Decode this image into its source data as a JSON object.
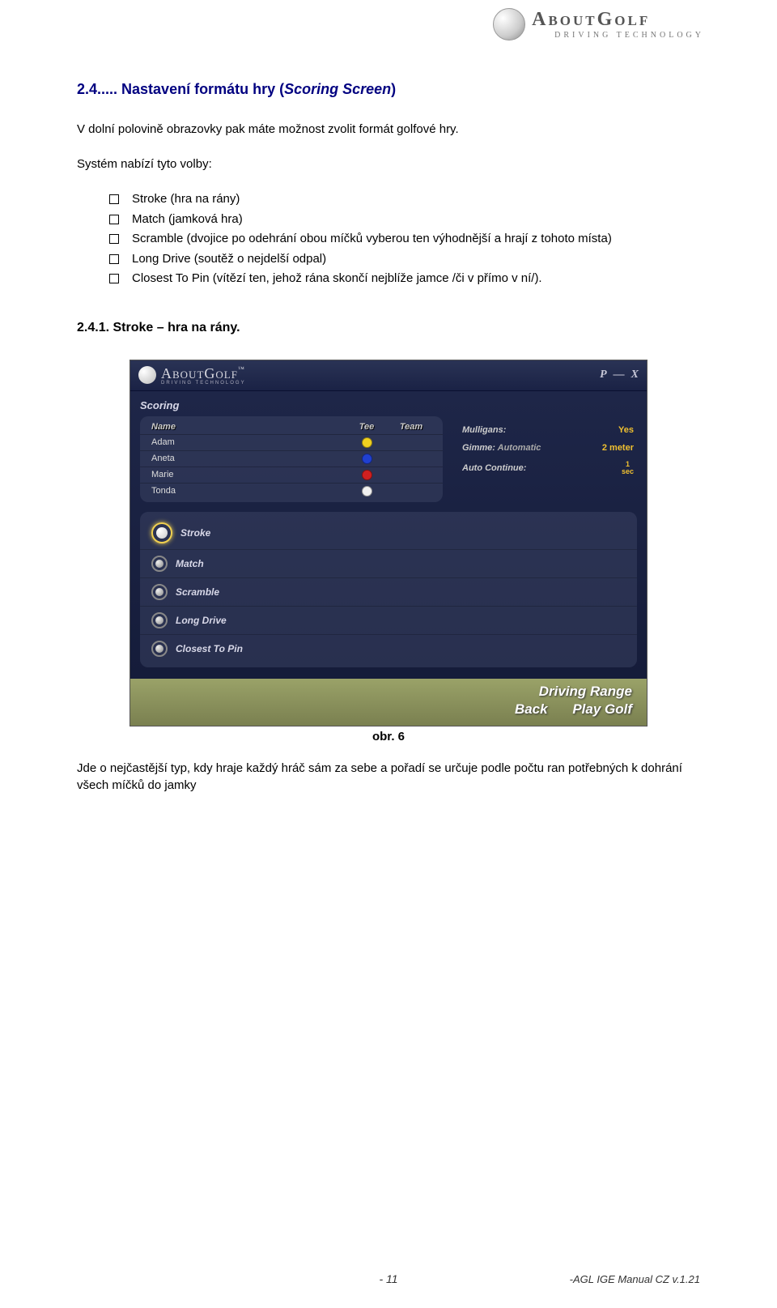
{
  "logo": {
    "brand_a": "About",
    "brand_b": "Golf",
    "sub": "DRIVING  TECHNOLOGY"
  },
  "heading": {
    "num": "2.4..... Nastavení formátu hry (",
    "italic": "Scoring Screen",
    "end": ")"
  },
  "intro": "V dolní polovině obrazovky pak máte možnost zvolit formát golfové hry.",
  "list_intro": "Systém nabízí tyto volby:",
  "bullets": [
    "Stroke (hra na rány)",
    "Match (jamková hra)",
    "Scramble (dvojice po odehrání obou míčků vyberou ten výhodnější a hrají z tohoto místa)",
    "Long Drive (soutěž o nejdelší odpal)",
    "Closest To Pin (vítězí ten, jehož rána skončí nejblíže jamce /či v přímo v ní/)."
  ],
  "subheading": "2.4.1.  Stroke – hra na rány.",
  "app": {
    "logo_a": "About",
    "logo_b": "Golf",
    "logo_tm": "™",
    "logo_sub": "DRIVING  TECHNOLOGY",
    "win_btns": [
      "P",
      "—",
      "X"
    ],
    "section_title": "Scoring",
    "players_header": {
      "name": "Name",
      "tee": "Tee",
      "team": "Team"
    },
    "players": [
      {
        "name": "Adam",
        "tee_color": "#f0d020"
      },
      {
        "name": "Aneta",
        "tee_color": "#2040d0"
      },
      {
        "name": "Marie",
        "tee_color": "#d02020"
      },
      {
        "name": "Tonda",
        "tee_color": "#f0f0f0"
      }
    ],
    "settings": [
      {
        "label": "Mulligans:",
        "value": "Yes",
        "type": "yellow"
      },
      {
        "label": "Gimme:",
        "value": "Automatic",
        "meter": "2 meter"
      },
      {
        "label": "Auto Continue:",
        "sec_top": "1",
        "sec_bot": "sec"
      }
    ],
    "modes": [
      {
        "label": "Stroke",
        "selected": true
      },
      {
        "label": "Match",
        "selected": false
      },
      {
        "label": "Scramble",
        "selected": false
      },
      {
        "label": "Long Drive",
        "selected": false
      },
      {
        "label": "Closest To Pin",
        "selected": false
      }
    ],
    "footer": {
      "driving": "Driving Range",
      "back": "Back",
      "play": "Play Golf"
    }
  },
  "caption": "obr. 6",
  "outro": "Jde o nejčastější typ, kdy hraje každý hráč sám za sebe a pořadí se určuje podle počtu ran potřebných k dohrání všech míčků do jamky",
  "footer_page": "- 11",
  "footer_doc": "-AGL IGE Manual CZ v.1.21"
}
